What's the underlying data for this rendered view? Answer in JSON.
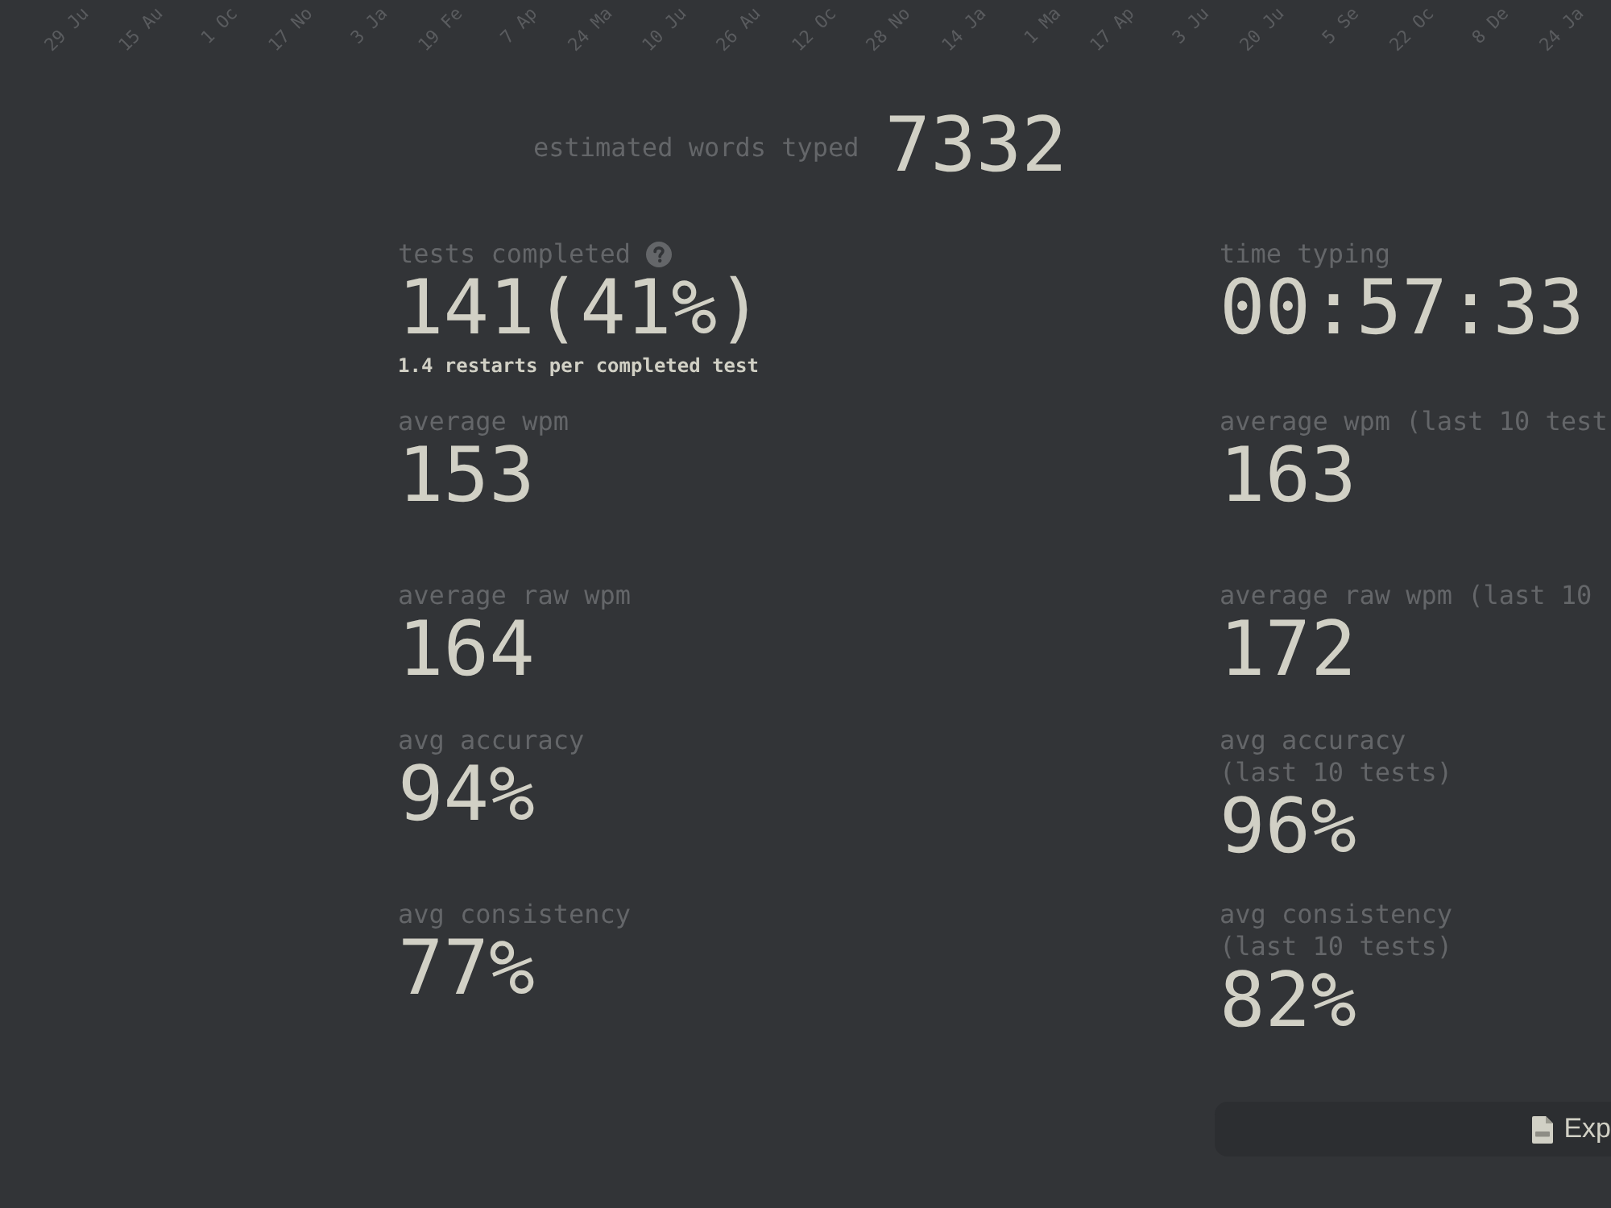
{
  "timeline_axis": {
    "labels": [
      "29 Ju",
      "15 Au",
      "1 Oc",
      "17 No",
      "3 Ja",
      "19 Fe",
      "7 Ap",
      "24 Ma",
      "10 Ju",
      "26 Au",
      "12 Oc",
      "28 No",
      "14 Ja",
      "1 Ma",
      "17 Ap",
      "3 Ju",
      "20 Ju",
      "5 Se",
      "22 Oc",
      "8 De",
      "24 Ja"
    ]
  },
  "words_typed": {
    "label": "estimated words typed",
    "value": "7332"
  },
  "stat_rows": [
    {
      "left": {
        "label": "tests completed",
        "help": true,
        "value": "141(41%)",
        "note": "1.4 restarts per completed test"
      },
      "right": {
        "label": "time typing",
        "value": "00:57:33"
      }
    },
    {
      "left": {
        "label": "average wpm",
        "value": "153"
      },
      "right": {
        "label": "average wpm (last 10 test",
        "value": "163"
      }
    },
    {
      "left": {
        "label": "average raw wpm",
        "value": "164"
      },
      "right": {
        "label": "average raw wpm (last 10",
        "value": "172"
      }
    },
    {
      "left": {
        "label": "avg accuracy",
        "value": "94%"
      },
      "right": {
        "label": "avg accuracy\n(last 10 tests)",
        "value": "96%"
      }
    },
    {
      "left": {
        "label": "avg consistency",
        "value": "77%"
      },
      "right": {
        "label": "avg consistency\n(last 10 tests)",
        "value": "82%"
      }
    }
  ],
  "export_button": {
    "label": "Exp"
  }
}
